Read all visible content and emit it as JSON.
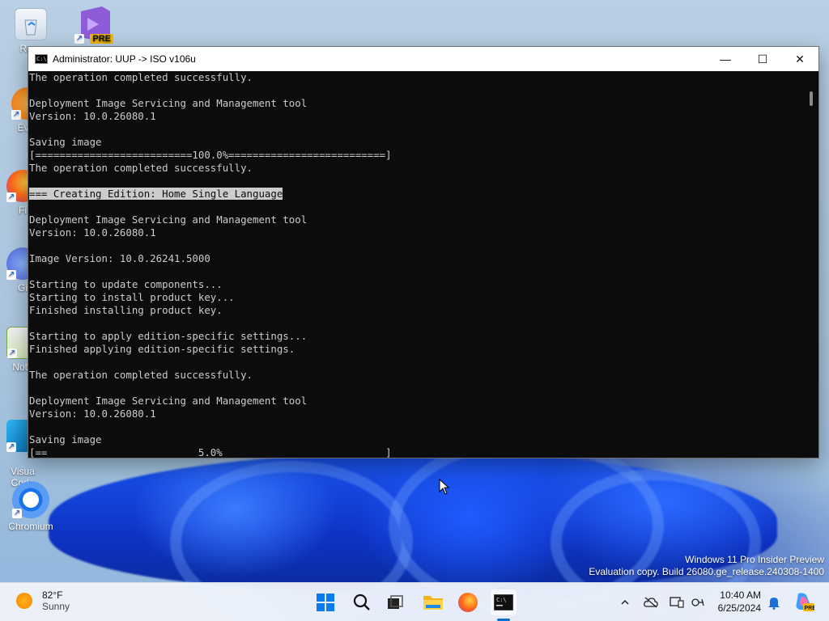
{
  "desktop": {
    "icons": [
      {
        "label": "Recy",
        "icon": "recycle-bin-icon"
      },
      {
        "label": "",
        "icon": "visual-studio-preview-icon",
        "badge": "PRE"
      },
      {
        "label": "Ever",
        "icon": "everything-icon"
      },
      {
        "label": "Fi",
        "icon": "firefox-icon"
      },
      {
        "label": "Gi",
        "icon": "github-icon"
      },
      {
        "label": "Note",
        "icon": "notepad-plus-plus-icon"
      },
      {
        "label": "Visua\nCode",
        "icon": "vscode-icon"
      },
      {
        "label": "Chromium",
        "icon": "chromium-icon"
      }
    ],
    "watermark": {
      "line1": "Windows 11 Pro Insider Preview",
      "line2": "Evaluation copy. Build 26080.ge_release.240308-1400"
    }
  },
  "window": {
    "title": "Administrator:  UUP -> ISO v106u",
    "icon_text": "C:\\",
    "controls": {
      "minimize": "—",
      "maximize": "☐",
      "close": "✕"
    },
    "console_lines": [
      "The operation completed successfully.",
      "",
      "Deployment Image Servicing and Management tool",
      "Version: 10.0.26080.1",
      "",
      "Saving image",
      "[==========================100.0%==========================]",
      "The operation completed successfully.",
      "",
      "=== Creating Edition: Home Single Language",
      "",
      "Deployment Image Servicing and Management tool",
      "Version: 10.0.26080.1",
      "",
      "Image Version: 10.0.26241.5000",
      "",
      "Starting to update components...",
      "Starting to install product key...",
      "Finished installing product key.",
      "",
      "Starting to apply edition-specific settings...",
      "Finished applying edition-specific settings.",
      "",
      "The operation completed successfully.",
      "",
      "Deployment Image Servicing and Management tool",
      "Version: 10.0.26080.1",
      "",
      "Saving image",
      "[==                         5.0%                           ]"
    ],
    "highlighted_line_index": 9
  },
  "taskbar": {
    "weather": {
      "temp": "82°F",
      "condition": "Sunny"
    },
    "apps": [
      "start-icon",
      "search-icon",
      "task-view-icon",
      "file-explorer-icon",
      "firefox-icon",
      "terminal-icon"
    ],
    "tray": [
      "chevron-up-icon",
      "cloud-offline-icon",
      "display-icon",
      "network-icon"
    ],
    "clock": {
      "time": "10:40 AM",
      "date": "6/25/2024"
    }
  }
}
